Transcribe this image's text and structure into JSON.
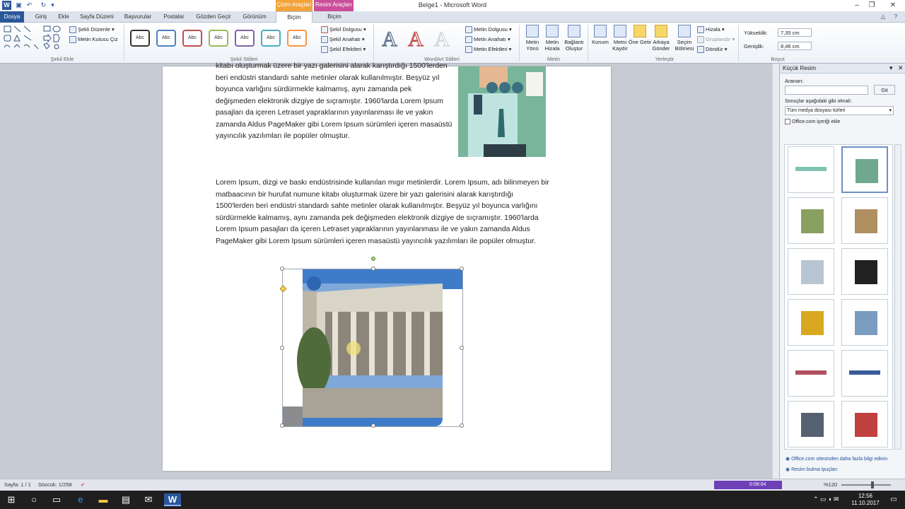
{
  "window": {
    "title": "Belge1  -  Microsoft Word",
    "minimize": "–",
    "maximize": "❐",
    "close": "✕",
    "help": "?",
    "ribbon_min": "△"
  },
  "context_tabs": {
    "drawing": "Çizim Araçları",
    "picture": "Resim Araçları"
  },
  "tabs": [
    {
      "label": "Dosya"
    },
    {
      "label": "Giriş"
    },
    {
      "label": "Ekle"
    },
    {
      "label": "Sayfa Düzeni"
    },
    {
      "label": "Başvurular"
    },
    {
      "label": "Postalar"
    },
    {
      "label": "Gözden Geçir"
    },
    {
      "label": "Görünüm"
    },
    {
      "label": "Biçim"
    },
    {
      "label": "Biçim"
    }
  ],
  "ribbon": {
    "insert_shapes": {
      "label": "Şekil Ekle",
      "edit_shape": "Şekli Düzenle",
      "draw_textbox": "Metin Kutusu Çiz"
    },
    "shape_styles": {
      "label": "Şekil Stilleri",
      "sample": "Abc",
      "fill": "Şekil Dolgusu",
      "outline": "Şekil Anahatı",
      "effects": "Şekil Efektleri",
      "colors": [
        "#333333",
        "#4f81bd",
        "#c0504d",
        "#9bbb59",
        "#8064a2",
        "#4bacc6",
        "#f79646"
      ]
    },
    "wordart": {
      "label": "WordArt Stilleri",
      "letter": "A",
      "fill": "Metin Dolgusu",
      "outline": "Metin Anahatı",
      "effects": "Metin Efektleri"
    },
    "text": {
      "label": "Metin",
      "direction": "Metin Yönü",
      "align": "Metin Hizala",
      "link": "Bağlantı Oluştur"
    },
    "arrange": {
      "label": "Yerleştir",
      "position": "Konum",
      "wrap": "Metni Kaydır",
      "forward": "Öne Getir",
      "backward": "Arkaya Gönder",
      "pane": "Seçim Bölmesi",
      "align": "Hizala",
      "group": "Gruplandır",
      "rotate": "Döndür"
    },
    "size": {
      "label": "Boyut",
      "height_label": "Yükseklik:",
      "height": "7,35 cm",
      "width_label": "Genişlik:",
      "width": "8,46 cm"
    }
  },
  "document": {
    "para1": "kitabı oluşturmak üzere bir yazı galerisini alarak karıştırdığı 1500'lerden beri endüstri standardı sahte metinler olarak kullanılmıştır. Beşyüz yıl boyunca varlığını sürdürmekle kalmamış, aynı zamanda pek değişmeden elektronik dizgiye de sıçramıştır. 1960'larda Lorem Ipsum pasajları da içeren Letraset yapraklarının yayınlanması ile ve yakın zamanda Aldus PageMaker gibi Lorem Ipsum sürümleri içeren masaüstü yayıncılık yazılımları ile popüler olmuştur.",
    "para2": "Lorem Ipsum, dizgi ve baskı endüstrisinde kullanılan mıgır metinlerdir. Lorem Ipsum, adı bilinmeyen bir matbaacının bir hurufat numune kitabı oluşturmak üzere bir yazı galerisini alarak karıştırdığı 1500'lerden beri endüstri standardı sahte metinler olarak kullanılmıştır. Beşyüz yıl boyunca varlığını sürdürmekle kalmamış, aynı zamanda pek değişmeden elektronik dizgiye de sıçramıştır. 1960'larda Lorem Ipsum pasajları da içeren Letraset yapraklarının yayınlanması ile ve yakın zamanda Aldus PageMaker gibi Lorem Ipsum sürümleri içeren masaüstü yayıncılık yazılımları ile popüler olmuştur."
  },
  "clipart": {
    "title": "Küçük Resim",
    "search_label": "Aranan:",
    "search_value": "",
    "go": "Git",
    "results_label": "Sonuçlar aşağıdaki gibi olmalı:",
    "media_type": "Tüm medya dosyası türleri",
    "include_office": "Office.com içeriği ekle",
    "link1": "Office.com sitesinden daha fazla bilgi edinin",
    "link2": "Resim bulma ipuçları"
  },
  "status": {
    "page": "Sayfa: 1 / 1",
    "words": "Sözcük: 1/258",
    "zoom": "%120",
    "timer": "0:08:04"
  },
  "clock": {
    "time": "12:56",
    "date": "11.10.2017"
  }
}
